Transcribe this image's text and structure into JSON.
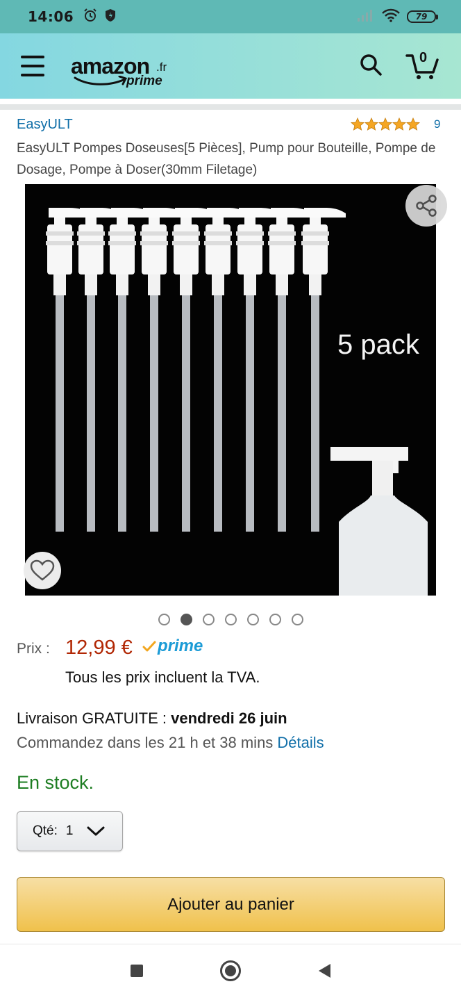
{
  "status_bar": {
    "time": "14:06",
    "battery": "79",
    "icons": [
      "alarm-icon",
      "shield-icon",
      "signal-icon",
      "wifi-icon",
      "battery-icon"
    ]
  },
  "header": {
    "logo_word": "amazon",
    "logo_suffix": ".fr",
    "logo_sub": "prime",
    "cart_count": "0",
    "icons": [
      "menu-icon",
      "search-icon",
      "cart-icon"
    ],
    "background": "#8fdbdc"
  },
  "product": {
    "brand": "EasyULT",
    "rating_stars": 5,
    "rating_count": "9",
    "title": "EasyULT Pompes Doseuses[5 Pièces], Pump pour Bouteille, Pompe de Dosage, Pompe à Doser(30mm Filetage)",
    "image_text": "5 pack",
    "image_count": 7,
    "active_image_index": 1
  },
  "price": {
    "label": "Prix :",
    "value": "12,99 €",
    "prime_label": "prime",
    "vat_note": "Tous les prix incluent la TVA.",
    "color": "#b12704"
  },
  "delivery": {
    "prefix": "Livraison GRATUITE : ",
    "date": "vendredi 26 juin",
    "order_within": "Commandez dans les 21 h et 38 mins ",
    "details_link": "Détails"
  },
  "stock": {
    "text": "En stock.",
    "color": "#1d7d22"
  },
  "quantity": {
    "label": "Qté:",
    "value": "1"
  },
  "actions": {
    "add_to_cart": "Ajouter au panier"
  },
  "nav": {
    "icons": [
      "recents-icon",
      "home-icon",
      "back-icon"
    ]
  }
}
